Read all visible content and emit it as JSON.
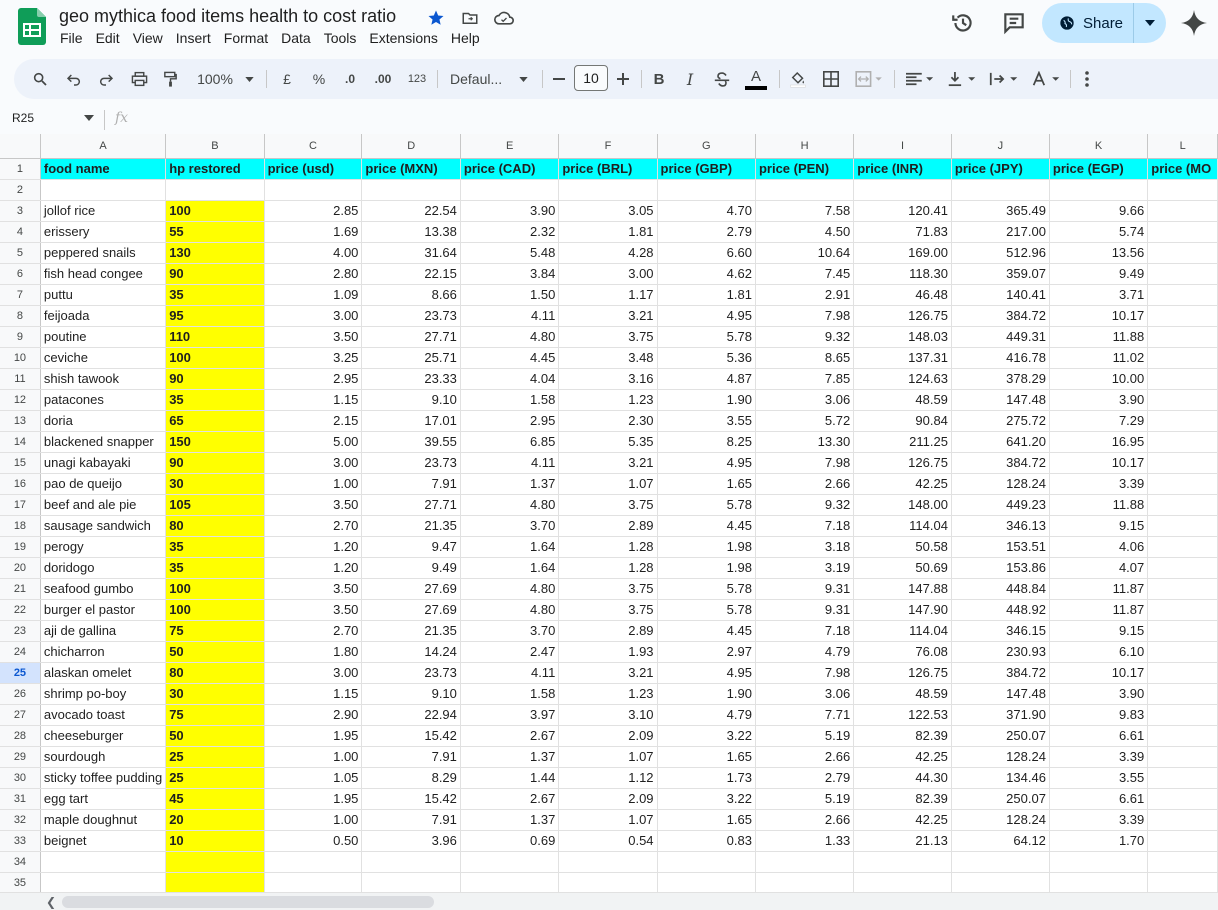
{
  "app": {
    "doc_title": "geo mythica food items health to cost ratio",
    "menus": [
      "File",
      "Edit",
      "View",
      "Insert",
      "Format",
      "Data",
      "Tools",
      "Extensions",
      "Help"
    ],
    "share_label": "Share",
    "accent": "#c2e7ff",
    "star_color": "#0b57d0"
  },
  "toolbar": {
    "zoom": "100%",
    "currency": "£",
    "percent": "%",
    "dec_decrease": ".0",
    "dec_increase": ".00",
    "number_format": "123",
    "font": "Defaul...",
    "font_size": "10",
    "bold": "B",
    "italic": "I",
    "text_color_glyph": "A"
  },
  "formula_bar": {
    "cell_ref": "R25",
    "fx": "fx",
    "content": ""
  },
  "grid": {
    "columns": [
      "A",
      "B",
      "C",
      "D",
      "E",
      "F",
      "G",
      "H",
      "I",
      "J",
      "K",
      "L"
    ],
    "active_row": 25,
    "header": [
      "food name",
      "hp restored",
      "price (usd)",
      "price (MXN)",
      "price (CAD)",
      "price (BRL)",
      "price (GBP)",
      "price (PEN)",
      "price (INR)",
      "price (JPY)",
      "price (EGP)",
      "price (MO"
    ],
    "rows": [
      [
        "jollof rice",
        "100",
        "2.85",
        "22.54",
        "3.90",
        "3.05",
        "4.70",
        "7.58",
        "120.41",
        "365.49",
        "9.66"
      ],
      [
        "erissery",
        "55",
        "1.69",
        "13.38",
        "2.32",
        "1.81",
        "2.79",
        "4.50",
        "71.83",
        "217.00",
        "5.74"
      ],
      [
        "peppered snails",
        "130",
        "4.00",
        "31.64",
        "5.48",
        "4.28",
        "6.60",
        "10.64",
        "169.00",
        "512.96",
        "13.56"
      ],
      [
        "fish head congee",
        "90",
        "2.80",
        "22.15",
        "3.84",
        "3.00",
        "4.62",
        "7.45",
        "118.30",
        "359.07",
        "9.49"
      ],
      [
        "puttu",
        "35",
        "1.09",
        "8.66",
        "1.50",
        "1.17",
        "1.81",
        "2.91",
        "46.48",
        "140.41",
        "3.71"
      ],
      [
        "feijoada",
        "95",
        "3.00",
        "23.73",
        "4.11",
        "3.21",
        "4.95",
        "7.98",
        "126.75",
        "384.72",
        "10.17"
      ],
      [
        "poutine",
        "110",
        "3.50",
        "27.71",
        "4.80",
        "3.75",
        "5.78",
        "9.32",
        "148.03",
        "449.31",
        "11.88"
      ],
      [
        "ceviche",
        "100",
        "3.25",
        "25.71",
        "4.45",
        "3.48",
        "5.36",
        "8.65",
        "137.31",
        "416.78",
        "11.02"
      ],
      [
        "shish tawook",
        "90",
        "2.95",
        "23.33",
        "4.04",
        "3.16",
        "4.87",
        "7.85",
        "124.63",
        "378.29",
        "10.00"
      ],
      [
        "patacones",
        "35",
        "1.15",
        "9.10",
        "1.58",
        "1.23",
        "1.90",
        "3.06",
        "48.59",
        "147.48",
        "3.90"
      ],
      [
        "doria",
        "65",
        "2.15",
        "17.01",
        "2.95",
        "2.30",
        "3.55",
        "5.72",
        "90.84",
        "275.72",
        "7.29"
      ],
      [
        "blackened snapper",
        "150",
        "5.00",
        "39.55",
        "6.85",
        "5.35",
        "8.25",
        "13.30",
        "211.25",
        "641.20",
        "16.95"
      ],
      [
        "unagi kabayaki",
        "90",
        "3.00",
        "23.73",
        "4.11",
        "3.21",
        "4.95",
        "7.98",
        "126.75",
        "384.72",
        "10.17"
      ],
      [
        "pao de queijo",
        "30",
        "1.00",
        "7.91",
        "1.37",
        "1.07",
        "1.65",
        "2.66",
        "42.25",
        "128.24",
        "3.39"
      ],
      [
        "beef and ale pie",
        "105",
        "3.50",
        "27.71",
        "4.80",
        "3.75",
        "5.78",
        "9.32",
        "148.00",
        "449.23",
        "11.88"
      ],
      [
        "sausage sandwich",
        "80",
        "2.70",
        "21.35",
        "3.70",
        "2.89",
        "4.45",
        "7.18",
        "114.04",
        "346.13",
        "9.15"
      ],
      [
        "perogy",
        "35",
        "1.20",
        "9.47",
        "1.64",
        "1.28",
        "1.98",
        "3.18",
        "50.58",
        "153.51",
        "4.06"
      ],
      [
        "doridogo",
        "35",
        "1.20",
        "9.49",
        "1.64",
        "1.28",
        "1.98",
        "3.19",
        "50.69",
        "153.86",
        "4.07"
      ],
      [
        "seafood gumbo",
        "100",
        "3.50",
        "27.69",
        "4.80",
        "3.75",
        "5.78",
        "9.31",
        "147.88",
        "448.84",
        "11.87"
      ],
      [
        "burger el pastor",
        "100",
        "3.50",
        "27.69",
        "4.80",
        "3.75",
        "5.78",
        "9.31",
        "147.90",
        "448.92",
        "11.87"
      ],
      [
        "aji de gallina",
        "75",
        "2.70",
        "21.35",
        "3.70",
        "2.89",
        "4.45",
        "7.18",
        "114.04",
        "346.15",
        "9.15"
      ],
      [
        "chicharron",
        "50",
        "1.80",
        "14.24",
        "2.47",
        "1.93",
        "2.97",
        "4.79",
        "76.08",
        "230.93",
        "6.10"
      ],
      [
        "alaskan omelet",
        "80",
        "3.00",
        "23.73",
        "4.11",
        "3.21",
        "4.95",
        "7.98",
        "126.75",
        "384.72",
        "10.17"
      ],
      [
        "shrimp po-boy",
        "30",
        "1.15",
        "9.10",
        "1.58",
        "1.23",
        "1.90",
        "3.06",
        "48.59",
        "147.48",
        "3.90"
      ],
      [
        "avocado toast",
        "75",
        "2.90",
        "22.94",
        "3.97",
        "3.10",
        "4.79",
        "7.71",
        "122.53",
        "371.90",
        "9.83"
      ],
      [
        "cheeseburger",
        "50",
        "1.95",
        "15.42",
        "2.67",
        "2.09",
        "3.22",
        "5.19",
        "82.39",
        "250.07",
        "6.61"
      ],
      [
        "sourdough",
        "25",
        "1.00",
        "7.91",
        "1.37",
        "1.07",
        "1.65",
        "2.66",
        "42.25",
        "128.24",
        "3.39"
      ],
      [
        "sticky toffee pudding",
        "25",
        "1.05",
        "8.29",
        "1.44",
        "1.12",
        "1.73",
        "2.79",
        "44.30",
        "134.46",
        "3.55"
      ],
      [
        "egg tart",
        "45",
        "1.95",
        "15.42",
        "2.67",
        "2.09",
        "3.22",
        "5.19",
        "82.39",
        "250.07",
        "6.61"
      ],
      [
        "maple doughnut",
        "20",
        "1.00",
        "7.91",
        "1.37",
        "1.07",
        "1.65",
        "2.66",
        "42.25",
        "128.24",
        "3.39"
      ],
      [
        "beignet",
        "10",
        "0.50",
        "3.96",
        "0.69",
        "0.54",
        "0.83",
        "1.33",
        "21.13",
        "64.12",
        "1.70"
      ]
    ],
    "trailing_empty_rows": 2
  }
}
